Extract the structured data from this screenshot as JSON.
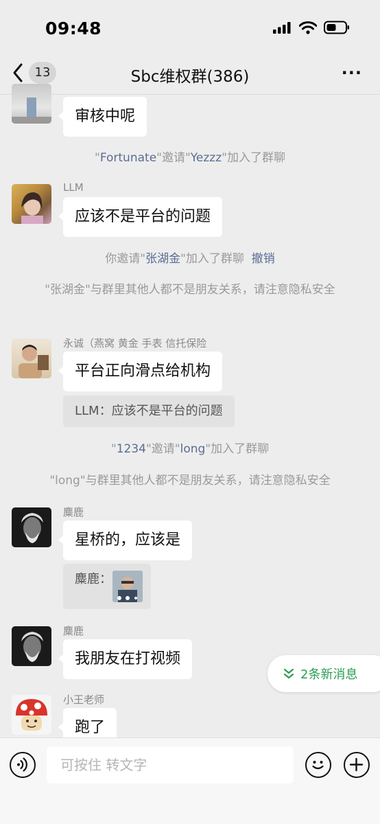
{
  "status_bar": {
    "time": "09:48"
  },
  "nav": {
    "back_count": "13",
    "title": "Sbc维权群(386)",
    "more": "···"
  },
  "messages": {
    "m0": {
      "text": "审核中呢"
    },
    "sys1": {
      "q1": "\"",
      "name1": "Fortunate",
      "mid": "\"邀请\"",
      "name2": "Yezzz",
      "tail": "\"加入了群聊"
    },
    "m1": {
      "sender": "LLM",
      "text": "应该不是平台的问题"
    },
    "sys2": {
      "pre": "你邀请\"",
      "name": "张湖金",
      "tail": "\"加入了群聊",
      "revoke": "撤销"
    },
    "sys3": {
      "text": "\"张湖金\"与群里其他人都不是朋友关系，请注意隐私安全"
    },
    "m2": {
      "sender": "永诚（燕窝 黄金 手表 信托保险",
      "text": "平台正向滑点给机构",
      "quote": "LLM：应该不是平台的问题"
    },
    "sys4": {
      "q1": "\"",
      "name1": "1234",
      "mid": "\"邀请\"",
      "name2": "long",
      "tail": "\"加入了群聊"
    },
    "sys5": {
      "text": "\"long\"与群里其他人都不是朋友关系，请注意隐私安全"
    },
    "m3": {
      "sender": "麋鹿",
      "text": "星桥的，应该是",
      "quote_label": "麋鹿："
    },
    "m4": {
      "sender": "麋鹿",
      "text": "我朋友在打视频"
    },
    "m5": {
      "sender": "小王老师",
      "text": "跑了"
    }
  },
  "new_messages": {
    "label": "2条新消息"
  },
  "input": {
    "placeholder": "可按住 转文字"
  },
  "colors": {
    "background": "#ededed",
    "accent_green": "#2a9d52",
    "link_blue": "#5a6d94"
  }
}
